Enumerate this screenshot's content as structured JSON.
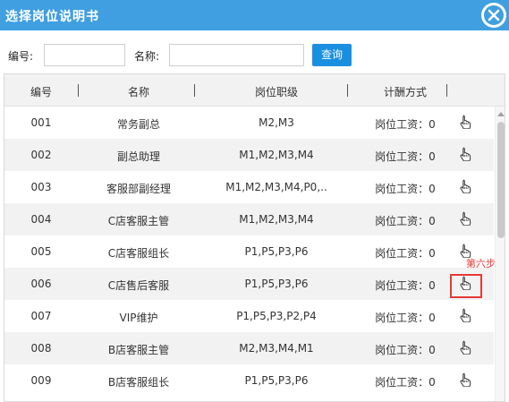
{
  "dialog": {
    "title": "选择岗位说明书"
  },
  "search": {
    "code_label": "编号:",
    "code_value": "",
    "name_label": "名称:",
    "name_value": "",
    "button_label": "查询"
  },
  "table": {
    "headers": [
      "编号",
      "名称",
      "岗位职级",
      "计酬方式"
    ],
    "rows": [
      {
        "code": "001",
        "name": "常务副总",
        "grades": "M2,M3",
        "pay": "岗位工资：0"
      },
      {
        "code": "002",
        "name": "副总助理",
        "grades": "M1,M2,M3,M4",
        "pay": "岗位工资：0"
      },
      {
        "code": "003",
        "name": "客服部副经理",
        "grades": "M1,M2,M3,M4,P0,..",
        "pay": "岗位工资：0"
      },
      {
        "code": "004",
        "name": "C店客服主管",
        "grades": "M1,M2,M3,M4",
        "pay": "岗位工资：0"
      },
      {
        "code": "005",
        "name": "C店客服组长",
        "grades": "P1,P5,P3,P6",
        "pay": "岗位工资：0"
      },
      {
        "code": "006",
        "name": "C店售后客服",
        "grades": "P1,P5,P3,P6",
        "pay": "岗位工资：0"
      },
      {
        "code": "007",
        "name": "VIP维护",
        "grades": "P1,P5,P3,P2,P4",
        "pay": "岗位工资：0"
      },
      {
        "code": "008",
        "name": "B店客服主管",
        "grades": "M2,M3,M4,M1",
        "pay": "岗位工资：0"
      },
      {
        "code": "009",
        "name": "B店客服组长",
        "grades": "P1,P5,P3,P6",
        "pay": "岗位工资：0"
      }
    ]
  },
  "annotation": {
    "text": "第六步",
    "color": "#e53935"
  },
  "colors": {
    "titlebar": "#3f9fe0",
    "button": "#1a8fe0",
    "row_alt": "#f2f2f2"
  },
  "icons": {
    "select": "hand-pointer-icon",
    "close": "close-icon"
  }
}
